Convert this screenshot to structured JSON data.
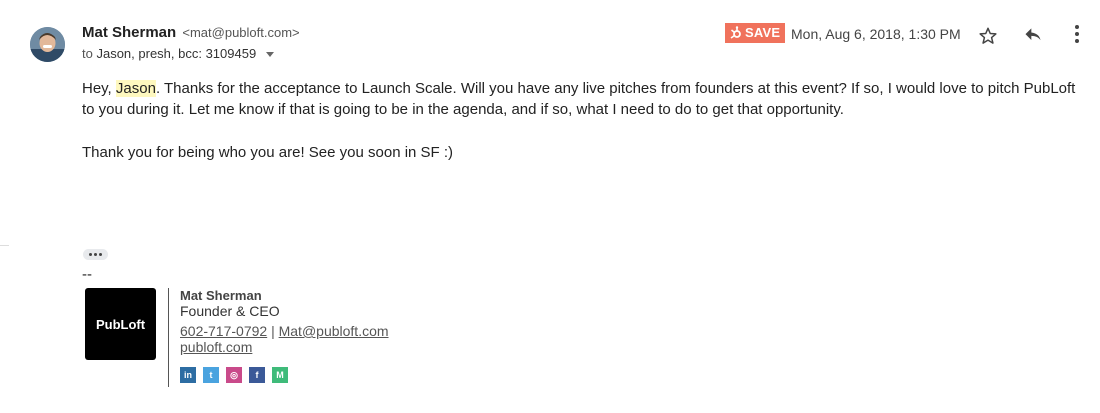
{
  "header": {
    "sender_name": "Mat Sherman",
    "sender_email": "<mat@publoft.com>",
    "to_prefix": "to",
    "recipients": "Jason, presh, bcc: 3109459",
    "save_label": "SAVE",
    "date": "Mon, Aug 6, 2018, 1:30 PM"
  },
  "icons": {
    "avatar": "avatar",
    "save": "hubspot-sprocket-icon",
    "star": "star-icon",
    "reply": "reply-icon",
    "more": "more-vert-icon",
    "expand_caret": "chevron-down-icon"
  },
  "message": {
    "greeting": "Hey, ",
    "name": "Jason",
    "p1_rest": ". Thanks for the acceptance to Launch Scale. Will you have any live pitches from founders at this event? If so, I would love to pitch PubLoft to you during it. Let me know if that is going to be in the agenda, and if so, what I need to do to get that opportunity.",
    "p2": "Thank you for being who you are! See you soon in SF :)"
  },
  "signature": {
    "dash": "--",
    "logo_text": "PubLoft",
    "name": "Mat Sherman",
    "title": "Founder & CEO",
    "phone": "602-717-0792",
    "separator": " | ",
    "email": "Mat@publoft.com",
    "website": "publoft.com",
    "social": [
      {
        "name": "linkedin-icon",
        "glyph": "in",
        "color": "#2d6da3"
      },
      {
        "name": "twitter-icon",
        "glyph": "t",
        "color": "#4aa3df"
      },
      {
        "name": "instagram-icon",
        "glyph": "◎",
        "color": "#c94a8a"
      },
      {
        "name": "facebook-icon",
        "glyph": "f",
        "color": "#3b5998"
      },
      {
        "name": "medium-icon",
        "glyph": "M",
        "color": "#3fbb7a"
      }
    ]
  },
  "colors": {
    "save_bg": "#f0725c",
    "highlight": "#fef8bf"
  }
}
